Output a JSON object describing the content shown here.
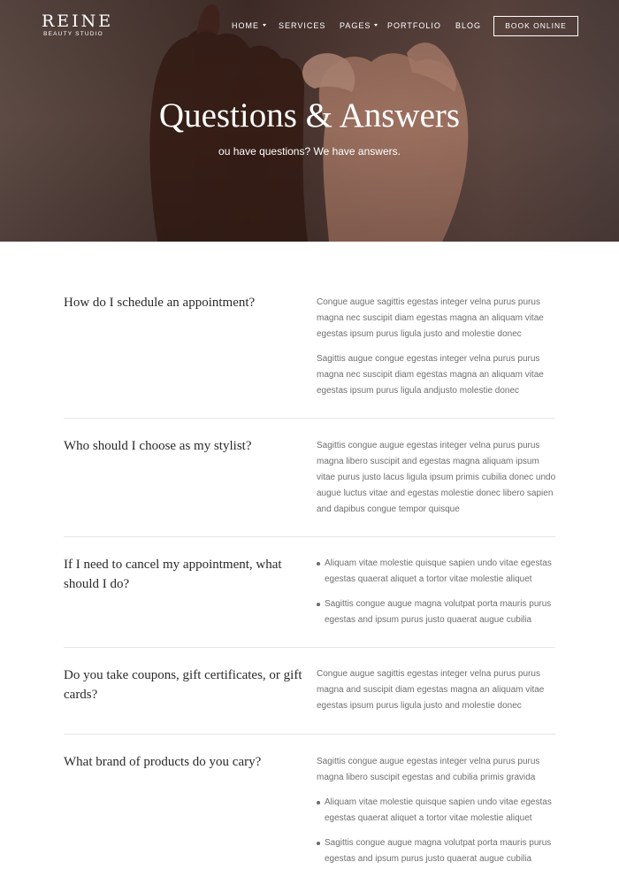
{
  "brand": {
    "name": "REINE",
    "tagline": "BEAUTY STUDIO"
  },
  "nav": {
    "items": [
      {
        "label": "HOME",
        "has_dropdown": true
      },
      {
        "label": "SERVICES",
        "has_dropdown": false
      },
      {
        "label": "PAGES",
        "has_dropdown": true
      },
      {
        "label": "PORTFOLIO",
        "has_dropdown": false
      },
      {
        "label": "BLOG",
        "has_dropdown": false
      }
    ],
    "cta_label": "BOOK ONLINE"
  },
  "hero": {
    "title": "Questions & Answers",
    "subtitle": "ou have questions? We have answers."
  },
  "faq": [
    {
      "question": "How do I schedule an appointment?",
      "paragraphs": [
        "Congue augue sagittis egestas integer velna purus purus magna nec suscipit diam egestas magna an aliquam vitae egestas ipsum purus ligula justo and molestie donec",
        "Sagittis augue congue egestas integer velna purus purus magna nec suscipit diam egestas magna an aliquam vitae egestas ipsum purus ligula andjusto molestie donec"
      ],
      "bullets": []
    },
    {
      "question": "Who should I choose as my stylist?",
      "paragraphs": [
        "Sagittis congue augue egestas integer velna purus purus magna libero suscipit and egestas magna aliquam ipsum vitae purus justo lacus ligula ipsum primis cubilia donec undo augue luctus vitae and egestas molestie donec libero sapien and dapibus congue tempor quisque"
      ],
      "bullets": []
    },
    {
      "question": "If I need to cancel my appointment, what should I do?",
      "paragraphs": [],
      "bullets": [
        "Aliquam vitae molestie quisque sapien undo vitae egestas egestas quaerat aliquet a tortor vitae molestie aliquet",
        "Sagittis congue augue magna volutpat porta mauris purus egestas and ipsum purus justo quaerat augue cubilia"
      ]
    },
    {
      "question": "Do you take coupons, gift certificates, or gift cards?",
      "paragraphs": [
        "Congue augue sagittis egestas integer velna purus purus magna and suscipit diam egestas magna an aliquam vitae egestas ipsum purus ligula justo and molestie donec"
      ],
      "bullets": []
    },
    {
      "question": "What brand of products do you cary?",
      "paragraphs": [
        "Sagittis congue augue egestas integer velna purus purus magna libero suscipit egestas and cubilia primis gravida"
      ],
      "bullets": [
        "Aliquam vitae molestie quisque sapien undo vitae egestas egestas quaerat aliquet a tortor vitae molestie aliquet",
        "Sagittis congue augue magna volutpat porta mauris purus egestas and ipsum purus justo quaerat augue cubilia"
      ]
    }
  ]
}
